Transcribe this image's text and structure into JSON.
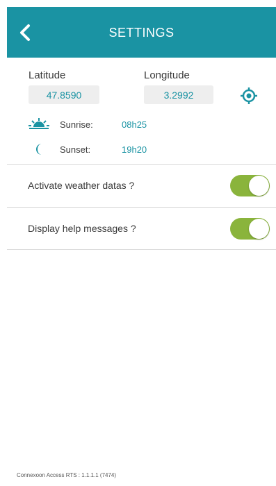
{
  "header": {
    "title": "SETTINGS"
  },
  "location": {
    "latitude_label": "Latitude",
    "latitude_value": "47.8590",
    "longitude_label": "Longitude",
    "longitude_value": "3.2992"
  },
  "sun": {
    "sunrise_label": "Sunrise:",
    "sunrise_value": "08h25",
    "sunset_label": "Sunset:",
    "sunset_value": "19h20"
  },
  "settings": [
    {
      "label": "Activate weather datas ?",
      "enabled": true
    },
    {
      "label": "Display help messages ?",
      "enabled": true
    }
  ],
  "footer": {
    "version": "Connexoon Access RTS : 1.1.1.1 (7474)"
  },
  "colors": {
    "accent": "#1a93a3",
    "toggle_on": "#8ab43c",
    "field_bg": "#eeeeee"
  },
  "icons": [
    "back-icon",
    "locate-icon",
    "sunrise-icon",
    "moon-icon"
  ]
}
